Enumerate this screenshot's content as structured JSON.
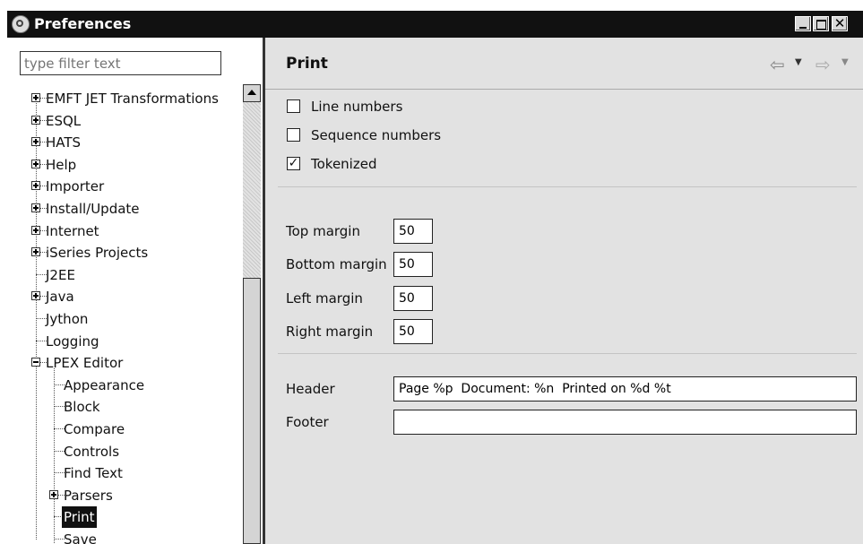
{
  "window": {
    "title": "Preferences"
  },
  "filter": {
    "placeholder": "type filter text"
  },
  "tree": {
    "items": [
      {
        "label": "EMFT JET Transformations",
        "expander": "plus",
        "level": 0
      },
      {
        "label": "ESQL",
        "expander": "plus",
        "level": 0
      },
      {
        "label": "HATS",
        "expander": "plus",
        "level": 0
      },
      {
        "label": "Help",
        "expander": "plus",
        "level": 0
      },
      {
        "label": "Importer",
        "expander": "plus",
        "level": 0
      },
      {
        "label": "Install/Update",
        "expander": "plus",
        "level": 0
      },
      {
        "label": "Internet",
        "expander": "plus",
        "level": 0
      },
      {
        "label": "iSeries Projects",
        "expander": "plus",
        "level": 0
      },
      {
        "label": "J2EE",
        "expander": "none",
        "level": 0
      },
      {
        "label": "Java",
        "expander": "plus",
        "level": 0
      },
      {
        "label": "Jython",
        "expander": "none",
        "level": 0
      },
      {
        "label": "Logging",
        "expander": "none",
        "level": 0
      },
      {
        "label": "LPEX Editor",
        "expander": "minus",
        "level": 0
      },
      {
        "label": "Appearance",
        "expander": "none",
        "level": 1
      },
      {
        "label": "Block",
        "expander": "none",
        "level": 1
      },
      {
        "label": "Compare",
        "expander": "none",
        "level": 1
      },
      {
        "label": "Controls",
        "expander": "none",
        "level": 1
      },
      {
        "label": "Find Text",
        "expander": "none",
        "level": 1
      },
      {
        "label": "Parsers",
        "expander": "plus",
        "level": 1
      },
      {
        "label": "Print",
        "expander": "none",
        "level": 1,
        "selected": true
      },
      {
        "label": "Save",
        "expander": "none",
        "level": 1
      }
    ]
  },
  "page": {
    "title": "Print",
    "nav": {
      "back_icon": "back-arrow-icon",
      "forward_icon": "forward-arrow-icon"
    },
    "checkboxes": [
      {
        "label": "Line numbers",
        "checked": false
      },
      {
        "label": "Sequence numbers",
        "checked": false
      },
      {
        "label": "Tokenized",
        "checked": true
      }
    ],
    "margins": {
      "top_label": "Top margin",
      "top_value": "50",
      "bottom_label": "Bottom margin",
      "bottom_value": "50",
      "left_label": "Left margin",
      "left_value": "50",
      "right_label": "Right margin",
      "right_value": "50"
    },
    "header_label": "Header",
    "header_value": "Page %p  Document: %n  Printed on %d %t",
    "footer_label": "Footer",
    "footer_value": ""
  }
}
